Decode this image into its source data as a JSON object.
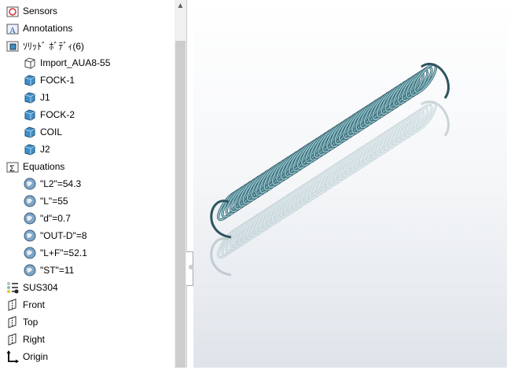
{
  "tree": {
    "items": [
      {
        "label": "Sensors",
        "icon": "sensors-folder-icon"
      },
      {
        "label": "Annotations",
        "icon": "annotations-folder-icon"
      },
      {
        "label": "ｿﾘｯﾄﾞ ﾎﾞﾃﾞｨ(6)",
        "icon": "solid-bodies-folder-icon"
      },
      {
        "label": "Import_AUA8-55",
        "icon": "wireframe-body-icon"
      },
      {
        "label": "FOCK-1",
        "icon": "solid-body-icon"
      },
      {
        "label": "J1",
        "icon": "solid-body-icon"
      },
      {
        "label": "FOCK-2",
        "icon": "solid-body-icon"
      },
      {
        "label": "COIL",
        "icon": "solid-body-icon"
      },
      {
        "label": "J2",
        "icon": "solid-body-icon"
      },
      {
        "label": "Equations",
        "icon": "equations-folder-icon"
      },
      {
        "label": "\"L2\"=54.3",
        "icon": "global-variable-icon"
      },
      {
        "label": "\"L\"=55",
        "icon": "global-variable-icon"
      },
      {
        "label": "\"d\"=0.7",
        "icon": "global-variable-icon"
      },
      {
        "label": "\"OUT-D\"=8",
        "icon": "global-variable-icon"
      },
      {
        "label": "\"L+F\"=52.1",
        "icon": "global-variable-icon"
      },
      {
        "label": "\"ST\"=11",
        "icon": "global-variable-icon"
      },
      {
        "label": "SUS304",
        "icon": "material-icon"
      },
      {
        "label": "Front",
        "icon": "plane-icon"
      },
      {
        "label": "Top",
        "icon": "plane-icon"
      },
      {
        "label": "Right",
        "icon": "plane-icon"
      },
      {
        "label": "Origin",
        "icon": "origin-icon"
      }
    ]
  },
  "colors": {
    "spring": "#8ec3cc",
    "spring_dark": "#2e5560",
    "body_blue": "#3f8fc9"
  }
}
